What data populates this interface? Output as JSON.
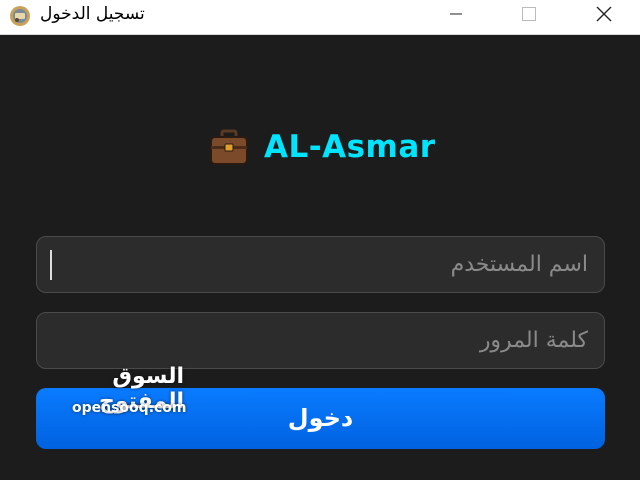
{
  "window": {
    "title": "تسجيل الدخول",
    "controls": {
      "minimize": "minimize",
      "maximize": "maximize",
      "close": "close"
    }
  },
  "brand": {
    "icon": "briefcase-icon",
    "name": "AL-Asmar",
    "color": "#00e5ff"
  },
  "form": {
    "username": {
      "value": "",
      "placeholder": "اسم المستخدم"
    },
    "password": {
      "value": "",
      "placeholder": "كلمة المرور"
    },
    "submit_label": "دخول"
  },
  "colors": {
    "background": "#1c1c1c",
    "field_bg": "#2c2c2c",
    "button": "#0a7bff"
  },
  "watermark": {
    "arabic": "السوق المفتوح",
    "latin": "opensooq.com"
  }
}
